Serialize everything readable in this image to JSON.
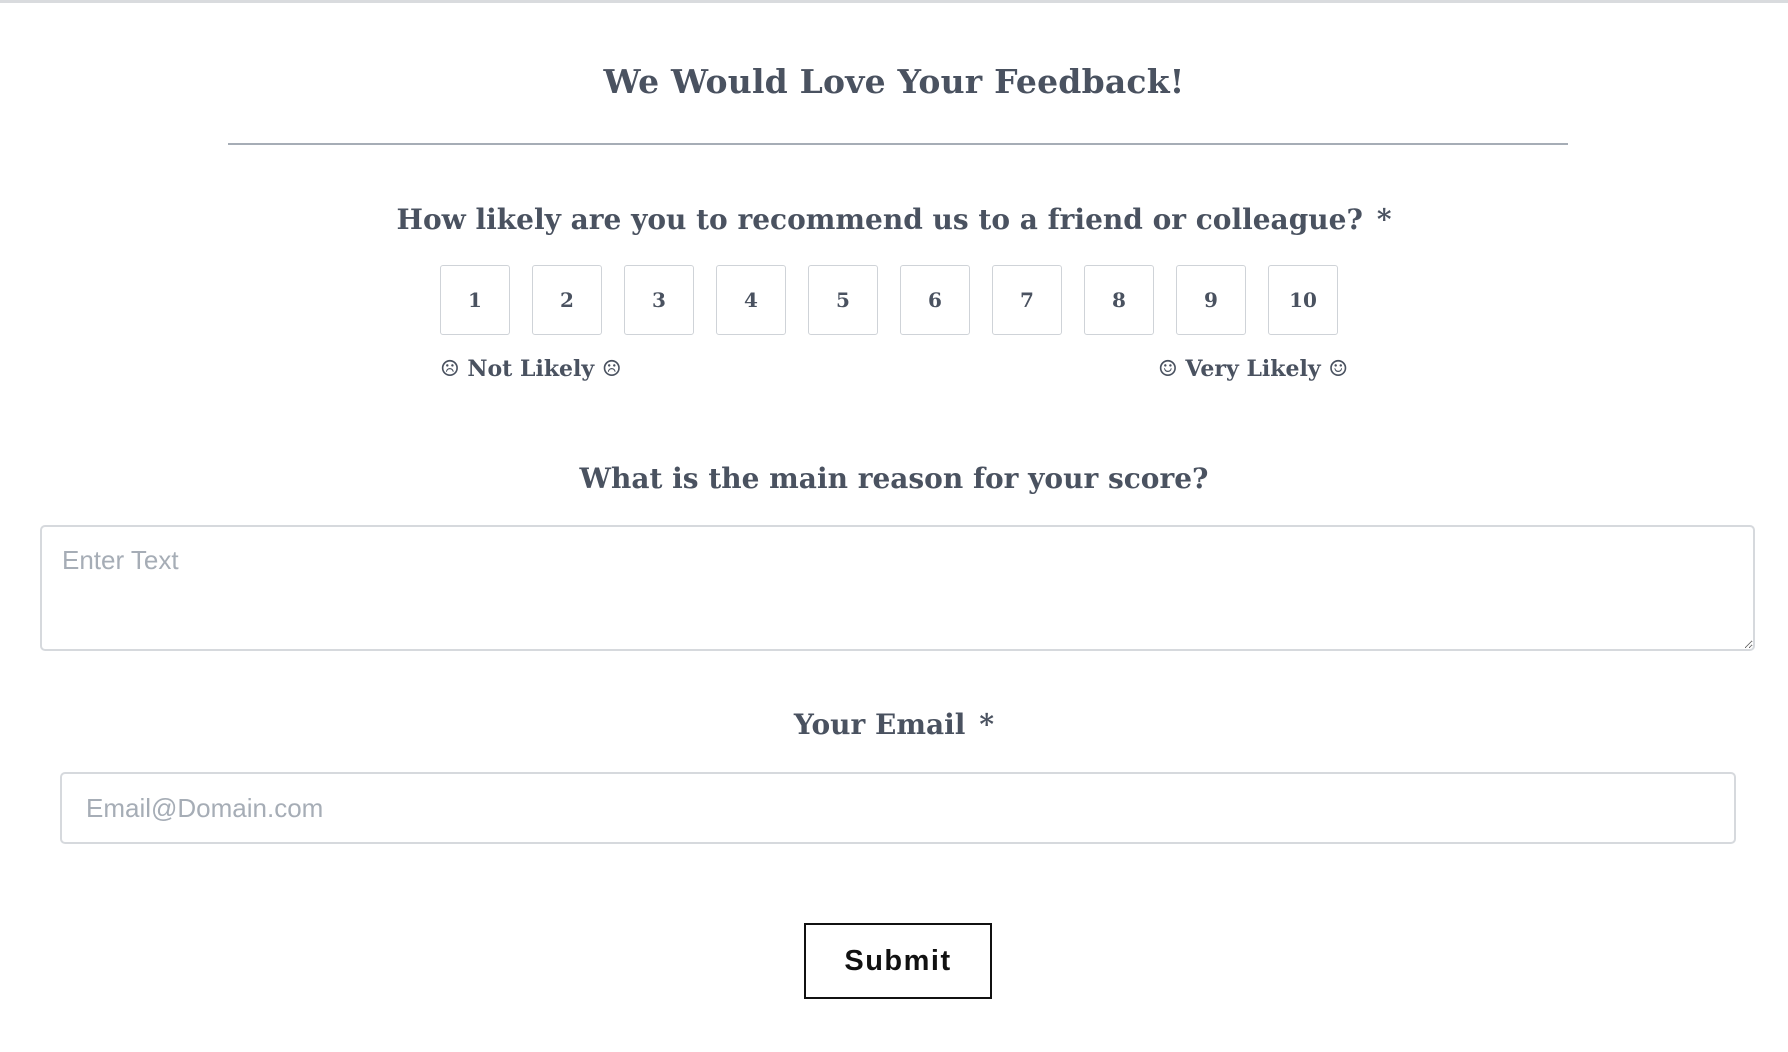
{
  "form": {
    "title": "We Would Love Your Feedback!"
  },
  "nps_question": {
    "label": "How likely are you to recommend us to a friend or colleague?",
    "required_mark": "*",
    "options": [
      "1",
      "2",
      "3",
      "4",
      "5",
      "6",
      "7",
      "8",
      "9",
      "10"
    ],
    "low_caption": "☹ Not Likely ☹",
    "high_caption": "☺ Very Likely ☺"
  },
  "reason_question": {
    "label": "What is the main reason for your score?",
    "placeholder": "Enter Text",
    "value": ""
  },
  "email_question": {
    "label": "Your Email",
    "required_mark": "*",
    "placeholder": "Email@Domain.com",
    "value": ""
  },
  "submit": {
    "label": "Submit"
  },
  "colors": {
    "text": "#4a5260",
    "border": "#d6d9dd",
    "placeholder": "#a6adb6",
    "button_border": "#111111"
  }
}
